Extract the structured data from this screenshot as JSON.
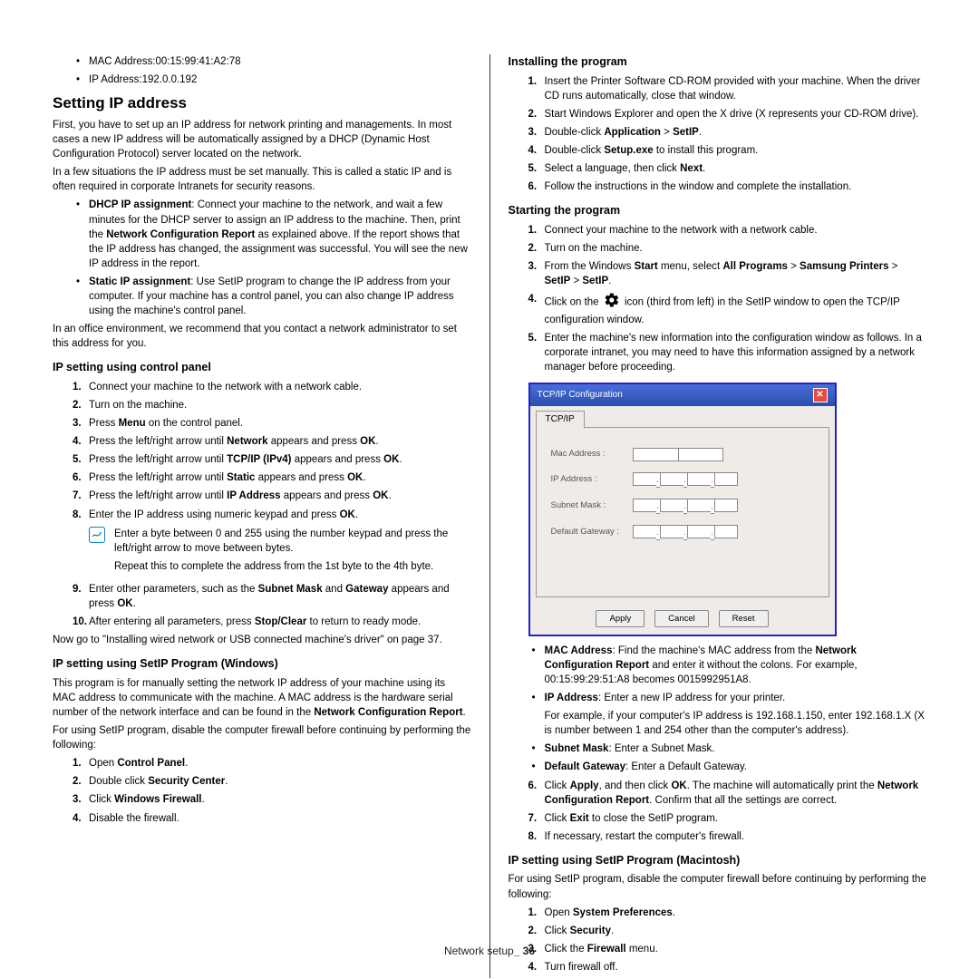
{
  "left": {
    "bullets_top": [
      "MAC Address:00:15:99:41:A2:78",
      "IP Address:192.0.0.192"
    ],
    "h2": "Setting IP address",
    "p1": "First, you have to set up an IP address for network printing and managements. In most cases a new IP address will be automatically assigned by a DHCP (Dynamic Host Configuration Protocol) server located on the network.",
    "p2": "In a few situations the IP address must be set manually. This is called a static IP and is often required in corporate Intranets for security reasons.",
    "bul_a": {
      "b": "DHCP IP assignment",
      "t1": ": Connect your machine to the network, and wait a few minutes for the DHCP server to assign an IP address to the machine. Then, print the ",
      "b2": "Network Configuration Report",
      "t2": " as explained above. If the report shows that the IP address has changed, the assignment was successful. You will see the new IP address in the report."
    },
    "bul_b": {
      "b": "Static IP assignment",
      "t": ": Use SetIP program to change the IP address from your computer. If your machine has a control panel, you can also change IP address using the machine's control panel."
    },
    "p3": "In an office environment, we recommend that you contact a network administrator to set this address for you.",
    "h3a": "IP setting using control panel",
    "steps_a": [
      {
        "n": "1.",
        "t": "Connect your machine to the network with a network cable."
      },
      {
        "n": "2.",
        "t": "Turn on the machine."
      },
      {
        "n": "3.",
        "pre": "Press ",
        "b": "Menu",
        "post": " on the control panel."
      },
      {
        "n": "4.",
        "pre": "Press the left/right arrow until ",
        "b": "Network",
        "post": " appears and press ",
        "b2": "OK",
        "post2": "."
      },
      {
        "n": "5.",
        "pre": "Press the left/right arrow until ",
        "b": "TCP/IP (IPv4)",
        "post": " appears and press ",
        "b2": "OK",
        "post2": "."
      },
      {
        "n": "6.",
        "pre": "Press the left/right arrow until ",
        "b": "Static",
        "post": " appears and press ",
        "b2": "OK",
        "post2": "."
      },
      {
        "n": "7.",
        "pre": "Press the left/right arrow until ",
        "b": "IP Address",
        "post": " appears and press ",
        "b2": "OK",
        "post2": "."
      },
      {
        "n": "8.",
        "pre": "Enter the IP address using numeric keypad and press ",
        "b": "OK",
        "post": "."
      }
    ],
    "note_a": "Enter a byte between 0 and 255 using the number keypad and press the left/right arrow to move between bytes.",
    "note_a2": "Repeat this to complete the address from the 1st byte to the 4th byte.",
    "step9": {
      "n": "9.",
      "pre": "Enter other parameters, such as the ",
      "b": "Subnet Mask",
      "mid": " and ",
      "b2": "Gateway",
      "post": " appears and press ",
      "b3": "OK",
      "post2": "."
    },
    "step10": {
      "n": "10.",
      "pre": "After entering all parameters, press ",
      "b": "Stop/Clear",
      "post": " to return to ready mode."
    },
    "p4": "Now go to \"Installing wired network or USB connected machine's driver\" on page 37.",
    "h3b": "IP setting using SetIP Program (Windows)",
    "p5a": "This program is for manually setting the network IP address of your machine using its MAC address to communicate with the machine. A MAC address is the hardware serial number of the network interface and can be found in the ",
    "p5b": "Network Configuration Report",
    "p6": "For using SetIP program, disable the computer firewall before continuing by performing the following:",
    "steps_b": [
      {
        "n": "1.",
        "pre": "Open ",
        "b": "Control Panel",
        "post": "."
      },
      {
        "n": "2.",
        "pre": "Double click ",
        "b": "Security Center",
        "post": "."
      },
      {
        "n": "3.",
        "pre": "Click ",
        "b": "Windows Firewall",
        "post": "."
      },
      {
        "n": "4.",
        "t": "Disable the firewall."
      }
    ]
  },
  "right": {
    "h3a": "Installing the program",
    "steps_a": [
      {
        "n": "1.",
        "t": "Insert the Printer Software CD-ROM provided with your machine. When the driver CD runs automatically, close that window."
      },
      {
        "n": "2.",
        "t": "Start Windows Explorer and open the X drive (X represents your CD-ROM drive)."
      },
      {
        "n": "3.",
        "pre": "Double-click ",
        "b": "Application",
        "mid": " > ",
        "b2": "SetIP",
        "post": "."
      },
      {
        "n": "4.",
        "pre": "Double-click ",
        "b": "Setup.exe",
        "post": " to install this program."
      },
      {
        "n": "5.",
        "pre": "Select a language, then click ",
        "b": "Next",
        "post": "."
      },
      {
        "n": "6.",
        "t": "Follow the instructions in the window and complete the installation."
      }
    ],
    "h3b": "Starting the program",
    "steps_b": [
      {
        "n": "1.",
        "t": "Connect your machine to the network with a network cable."
      },
      {
        "n": "2.",
        "t": "Turn on the machine."
      },
      {
        "n": "3.",
        "pre": "From the Windows ",
        "b": "Start",
        "mid": " menu, select ",
        "b2": "All Programs",
        "mid2": " > ",
        "b3": "Samsung Printers",
        "mid3": " > ",
        "b4": "SetIP",
        "mid4": " > ",
        "b5": "SetIP",
        "post": "."
      },
      {
        "n": "4.",
        "pre": "Click on the ",
        "post": " icon (third from left) in the SetIP window to open the TCP/IP configuration window."
      },
      {
        "n": "5.",
        "t": "Enter the machine's new information into the configuration window as follows. In a corporate intranet, you may need to have this information assigned by a network manager before proceeding."
      }
    ],
    "dialog": {
      "title": "TCP/IP Configuration",
      "tab": "TCP/IP",
      "labels": [
        "Mac Address :",
        "IP Address :",
        "Subnet Mask :",
        "Default Gateway :"
      ],
      "buttons": [
        "Apply",
        "Cancel",
        "Reset"
      ]
    },
    "sub": [
      {
        "b": "MAC Address",
        "t": ": Find the machine's MAC address from the ",
        "b2": "Network Configuration Report",
        "t2": " and enter it without the colons. For example, 00:15:99:29:51:A8 becomes 0015992951A8."
      },
      {
        "b": "IP Address",
        "t": ": Enter a new IP address for your printer.",
        "extra": "For example, if your computer's IP address is 192.168.1.150, enter 192.168.1.X (X is number between 1 and 254 other than the computer's address)."
      },
      {
        "b": "Subnet Mask",
        "t": ": Enter a Subnet Mask."
      },
      {
        "b": "Default Gateway",
        "t": ": Enter a Default Gateway."
      }
    ],
    "step6": {
      "n": "6.",
      "pre": "Click ",
      "b": "Apply",
      "mid": ", and then click ",
      "b2": "OK",
      "mid2": ". The machine will automatically print the ",
      "b3": "Network Configuration Report",
      "post": ". Confirm that all the settings are correct."
    },
    "step7": {
      "n": "7.",
      "pre": "Click ",
      "b": "Exit",
      "post": " to close the SetIP program."
    },
    "step8": {
      "n": "8.",
      "t": "If necessary, restart the computer's firewall."
    },
    "h3c": "IP setting using SetIP Program (Macintosh)",
    "p1": "For using SetIP program, disable the computer firewall before continuing by performing the following:",
    "steps_c": [
      {
        "n": "1.",
        "pre": "Open ",
        "b": "System Preferences",
        "post": "."
      },
      {
        "n": "2.",
        "pre": "Click ",
        "b": "Security",
        "post": "."
      },
      {
        "n": "3.",
        "pre": "Click the ",
        "b": "Firewall",
        "post": " menu."
      },
      {
        "n": "4.",
        "t": "Turn firewall off."
      }
    ]
  },
  "footer": {
    "a": "Network setup",
    "b": "_ 36"
  }
}
